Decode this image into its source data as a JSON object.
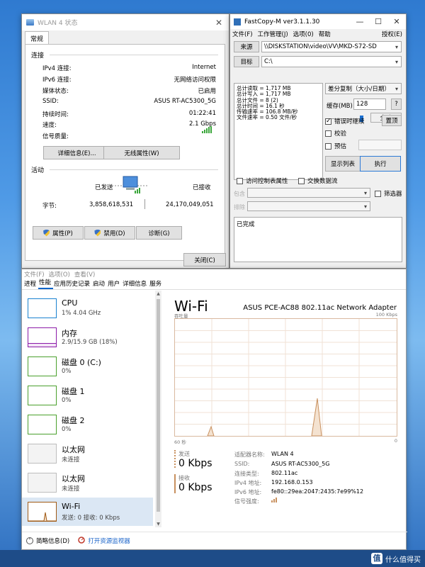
{
  "wlan": {
    "title": "WLAN 4 状态",
    "tab": "常规",
    "connection_group": "连接",
    "rows": [
      {
        "k": "IPv4 连接:",
        "v": "Internet"
      },
      {
        "k": "IPv6 连接:",
        "v": "无网络访问权限"
      },
      {
        "k": "媒体状态:",
        "v": "已启用"
      },
      {
        "k": "SSID:",
        "v": "ASUS RT-AC5300_5G"
      },
      {
        "k": "持续时间:",
        "v": "01:22:41"
      },
      {
        "k": "速度:",
        "v": "2.1 Gbps"
      },
      {
        "k": "信号质量:",
        "v": ""
      }
    ],
    "details_btn": "详细信息(E)...",
    "wireless_btn": "无线属性(W)",
    "activity_group": "活动",
    "sent_label": "已发送",
    "recv_label": "已接收",
    "bytes_label": "字节:",
    "bytes_sent": "3,858,618,531",
    "bytes_recv": "24,170,049,051",
    "properties_btn": "属性(P)",
    "disable_btn": "禁用(D)",
    "diagnose_btn": "诊断(G)",
    "close_btn": "关闭(C)"
  },
  "fastcopy": {
    "title": "FastCopy-M ver3.1.1.30",
    "menu": [
      "文件(F)",
      "工作管理(J)",
      "选项(0)",
      "帮助"
    ],
    "menu_right": "授权(E)",
    "source_btn": "来源",
    "source_path": "\\\\DISKSTATION\\video\\VV\\MKD-S72-SD",
    "dest_btn": "目标",
    "dest_path": "C:\\",
    "stats": [
      "总计读取 = 1,717 MB",
      "总计写入 = 1,717 MB",
      "总计文件 = 8 (2)",
      "总计时间 = 16.1 秒",
      "传输速率 = 106.8 MB/秒",
      "文件速率 = 0.50 文件/秒"
    ],
    "mode": "差分复制（大小/日期）",
    "buffer_label": "缓存(MB)",
    "buffer_value": "128",
    "help_btn": "?",
    "speed_label": "全速",
    "continue_on_error": "错误时继续",
    "verify": "校验",
    "estimate": "预估",
    "resize_btn": "置顶",
    "list_btn": "显示列表",
    "execute_btn": "执行",
    "acl": "访问控制表属性",
    "alt_stream": "交换数据流",
    "include_label": "包含",
    "exclude_label": "排除",
    "filter": "筛选器",
    "log": "已完成"
  },
  "taskmgr": {
    "menu": [
      "文件(F)",
      "选项(O)",
      "查看(V)"
    ],
    "tabs": [
      "进程",
      "性能",
      "应用历史记录",
      "启动",
      "用户",
      "详细信息",
      "服务"
    ],
    "active_tab": "性能",
    "sidebar": [
      {
        "name": "CPU",
        "sub": "1% 4.04 GHz",
        "color": "#1a82d0"
      },
      {
        "name": "内存",
        "sub": "2.9/15.9 GB (18%)",
        "color": "#8b1aa8"
      },
      {
        "name": "磁盘 0 (C:)",
        "sub": "0%",
        "color": "#4aa02c"
      },
      {
        "name": "磁盘 1",
        "sub": "0%",
        "color": "#4aa02c"
      },
      {
        "name": "磁盘 2",
        "sub": "0%",
        "color": "#4aa02c"
      },
      {
        "name": "以太网",
        "sub": "未连接",
        "color": "#a0a0a0"
      },
      {
        "name": "以太网",
        "sub": "未连接",
        "color": "#a0a0a0"
      },
      {
        "name": "Wi-Fi",
        "sub": "发送: 0 接收: 0 Kbps",
        "color": "#a05a14"
      }
    ],
    "title": "Wi-Fi",
    "adapter": "ASUS PCE-AC88 802.11ac Network Adapter",
    "throughput_label": "吞吐量",
    "max_label": "100 Kbps",
    "time_label": "60 秒",
    "zero_label": "0",
    "send_label": "发送",
    "send_value": "0 Kbps",
    "recv_label": "接收",
    "recv_value": "0 Kbps",
    "info": [
      {
        "k": "适配器名称:",
        "v": "WLAN 4"
      },
      {
        "k": "SSID:",
        "v": "ASUS RT-AC5300_5G"
      },
      {
        "k": "连接类型:",
        "v": "802.11ac"
      },
      {
        "k": "IPv4 地址:",
        "v": "192.168.0.153"
      },
      {
        "k": "IPv6 地址:",
        "v": "fe80::29ea:2047:2435:7e99%12"
      },
      {
        "k": "信号强度:",
        "v": ""
      }
    ],
    "fewer_details": "简略信息(D)",
    "open_monitor": "打开资源监视器"
  },
  "watermark": "什么值得买",
  "watermark_logo": "值"
}
